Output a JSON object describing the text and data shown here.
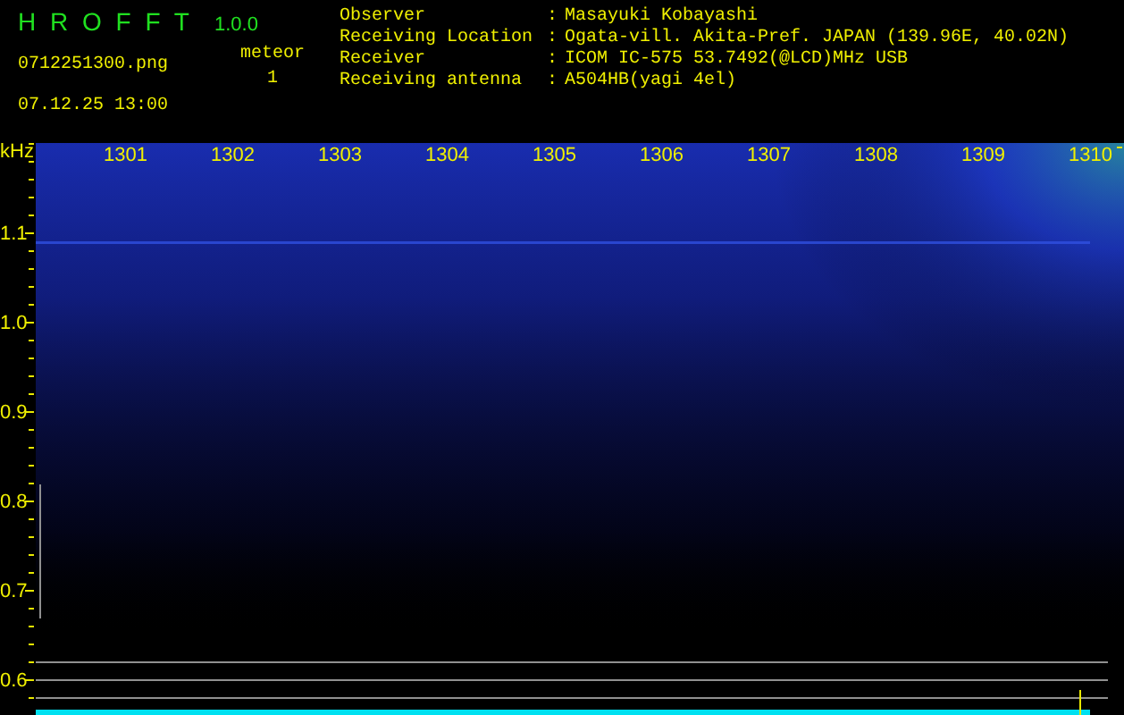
{
  "app": {
    "title": "H R O F F T",
    "version": "1.0.0",
    "filename": "0712251300.png",
    "datetime": "07.12.25 13:00",
    "meteor_label": "meteor",
    "meteor_count": "1"
  },
  "info": [
    {
      "label": "Observer",
      "separator": ":",
      "value": "Masayuki Kobayashi"
    },
    {
      "label": "Receiving Location",
      "separator": ":",
      "value": "Ogata-vill. Akita-Pref. JAPAN (139.96E, 40.02N)"
    },
    {
      "label": "Receiver",
      "separator": ":",
      "value": "ICOM IC-575 53.7492(@LCD)MHz USB"
    },
    {
      "label": "Receiving antenna",
      "separator": ":",
      "value": "A504HB(yagi 4el)"
    }
  ],
  "spectrogram": {
    "unit": "kHz",
    "x_labels": [
      "1301",
      "1302",
      "1303",
      "1304",
      "1305",
      "1306",
      "1307",
      "1308",
      "1309",
      "1310"
    ],
    "y_labels": [
      "1.1",
      "1.0",
      "0.9",
      "0.8",
      "0.7",
      "0.6"
    ]
  }
}
